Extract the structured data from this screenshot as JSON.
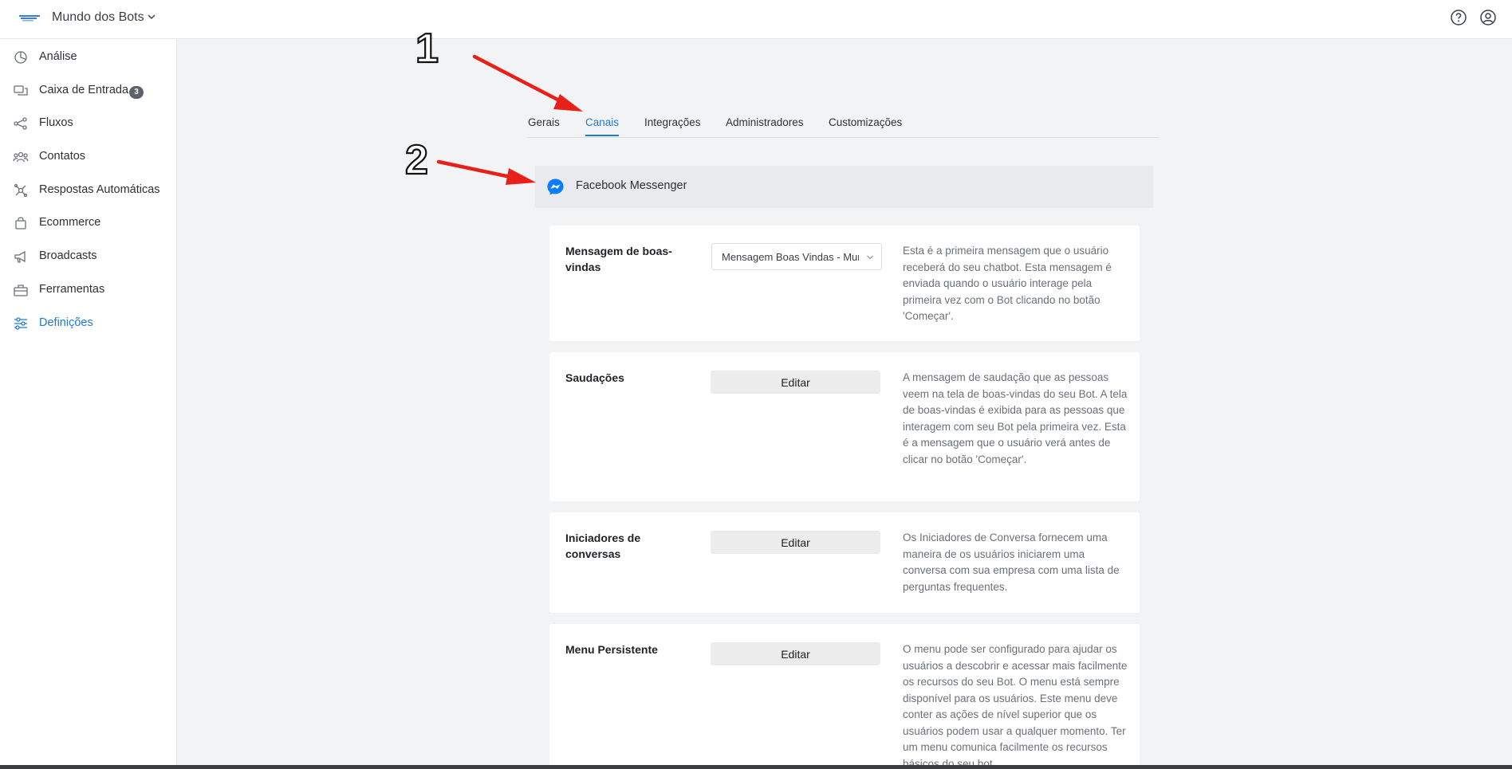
{
  "header": {
    "workspace_name": "Mundo dos Bots",
    "icons": [
      "logo-icon",
      "chevron-down-icon",
      "help-icon",
      "user-account-icon"
    ]
  },
  "sidebar": {
    "items": [
      {
        "label": "Análise",
        "icon": "pie-chart-icon"
      },
      {
        "label": "Caixa de Entrada",
        "icon": "chat-icon",
        "badge": "3"
      },
      {
        "label": "Fluxos",
        "icon": "flow-icon"
      },
      {
        "label": "Contatos",
        "icon": "contacts-icon"
      },
      {
        "label": "Respostas Automáticas",
        "icon": "auto-reply-icon"
      },
      {
        "label": "Ecommerce",
        "icon": "shopping-bag-icon"
      },
      {
        "label": "Broadcasts",
        "icon": "megaphone-icon"
      },
      {
        "label": "Ferramentas",
        "icon": "toolbox-icon"
      },
      {
        "label": "Definições",
        "icon": "sliders-icon",
        "active": true
      }
    ]
  },
  "tabs": [
    {
      "label": "Gerais"
    },
    {
      "label": "Canais",
      "active": true
    },
    {
      "label": "Integrações"
    },
    {
      "label": "Administradores"
    },
    {
      "label": "Customizações"
    }
  ],
  "channel": {
    "title": "Facebook Messenger",
    "icon": "messenger-icon"
  },
  "cards": [
    {
      "title": "Mensagem de boas-vindas",
      "control": "select",
      "select_value": "Mensagem Boas Vindas - Mundo dos Bots",
      "description": "Esta é a primeira mensagem que o usuário receberá do seu chatbot. Esta mensagem é enviada quando o usuário interage pela primeira vez com o Bot clicando no botão 'Começar'."
    },
    {
      "title": "Saudações",
      "control": "button",
      "button_label": "Editar",
      "description": "A mensagem de saudação que as pessoas veem na tela de boas-vindas do seu Bot. A tela de boas-vindas é exibida para as pessoas que interagem com seu Bot pela primeira vez. Esta é a mensagem que o usuário verá antes de clicar no botão 'Começar'."
    },
    {
      "title": "Iniciadores de conversas",
      "control": "button",
      "button_label": "Editar",
      "description": "Os Iniciadores de Conversa fornecem uma maneira de os usuários iniciarem uma conversa com sua empresa com uma lista de perguntas frequentes."
    },
    {
      "title": "Menu Persistente",
      "control": "button",
      "button_label": "Editar",
      "description": "O menu pode ser configurado para ajudar os usuários a descobrir e acessar mais facilmente os recursos do seu Bot. O menu está sempre disponível para os usuários. Este menu deve conter as ações de nível superior que os usuários podem usar a qualquer momento. Ter um menu comunica facilmente os recursos básicos do seu bot."
    }
  ],
  "annotations": {
    "marker_1": "1",
    "marker_2": "2",
    "arrow_color": "#e8201a"
  },
  "colors": {
    "accent": "#1f7ad4",
    "page_background": "#f2f3f5",
    "badge": "#5c636e",
    "messenger": "#0a7cff"
  }
}
